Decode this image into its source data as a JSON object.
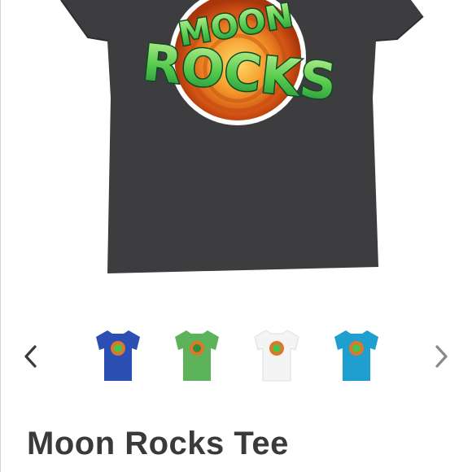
{
  "product": {
    "title": "Moon Rocks Tee",
    "hero_color": "#3d3d3f"
  },
  "logo": {
    "line1": "MOON",
    "line2": "ROCKS"
  },
  "carousel": {
    "prev_icon": "chevron-left-icon",
    "next_icon": "chevron-right-icon",
    "thumbnails": [
      {
        "color": "royal-blue",
        "hex": "#2b4fb3"
      },
      {
        "color": "green",
        "hex": "#5db35a"
      },
      {
        "color": "white",
        "hex": "#f4f4f4"
      },
      {
        "color": "aqua",
        "hex": "#1f9fd0"
      }
    ]
  }
}
